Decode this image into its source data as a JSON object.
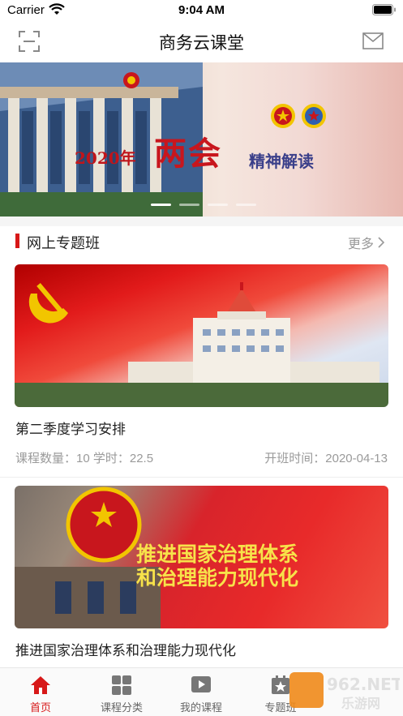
{
  "status_bar": {
    "carrier": "Carrier",
    "time": "9:04 AM"
  },
  "nav": {
    "title": "商务云课堂",
    "left_icon": "scan-icon",
    "right_icon": "mail-icon"
  },
  "banner": {
    "year": "2020年",
    "headline": "两会",
    "subtitle": "精神解读",
    "slide_count": 4,
    "active_slide": 1
  },
  "section": {
    "title": "网上专题班",
    "more_label": "更多"
  },
  "courses": [
    {
      "title": "第二季度学习安排",
      "meta": "课程数量：10 学时：22.5",
      "date": "开班时间：2020-04-13"
    },
    {
      "title": "推进国家治理体系和治理能力现代化",
      "image_text_line1": "推进国家治理体系",
      "image_text_line2": "和治理能力现代化"
    }
  ],
  "tabs": [
    {
      "label": "首页",
      "icon": "home-icon",
      "active": true
    },
    {
      "label": "课程分类",
      "icon": "grid-icon",
      "active": false
    },
    {
      "label": "我的课程",
      "icon": "play-icon",
      "active": false
    },
    {
      "label": "专题班",
      "icon": "star-icon",
      "active": false
    }
  ],
  "watermark": {
    "line1": "962.NET",
    "line2": "乐游网"
  },
  "colors": {
    "accent": "#d71818",
    "muted": "#9a9a9a"
  }
}
